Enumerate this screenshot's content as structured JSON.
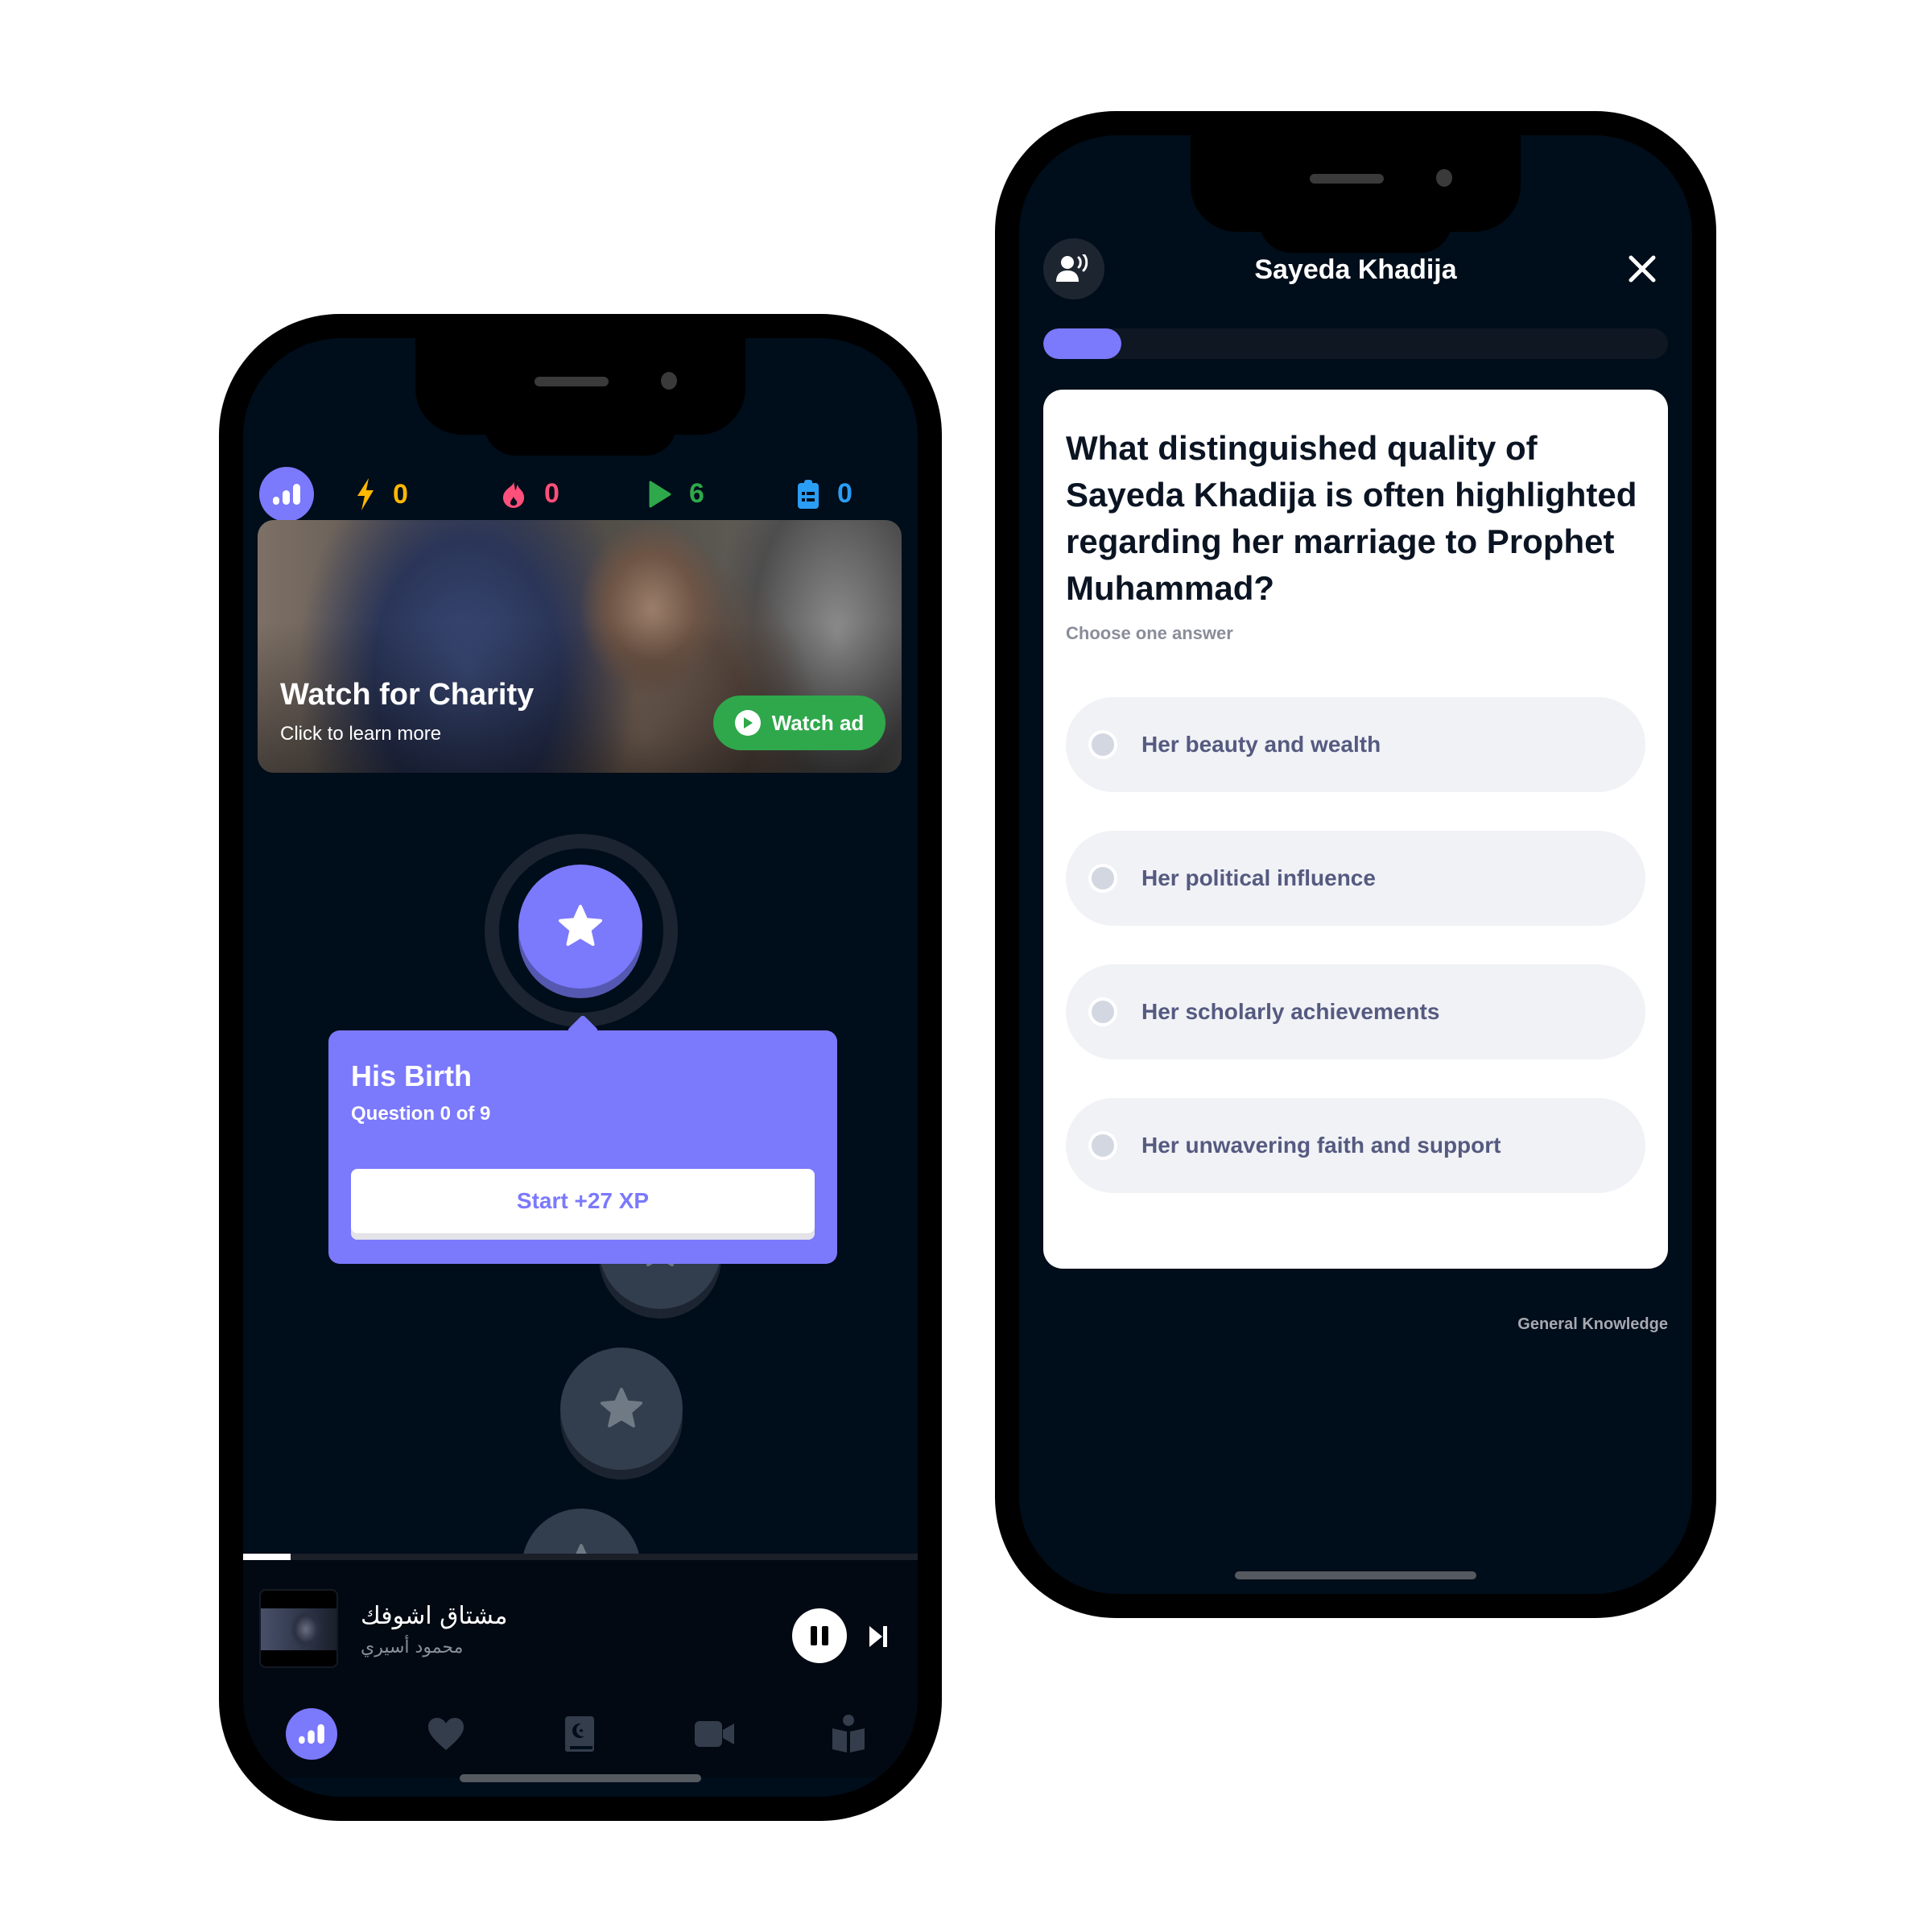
{
  "left_phone": {
    "stats": [
      {
        "icon": "lightning-icon",
        "value": "0",
        "color": "#ffb800"
      },
      {
        "icon": "flame-icon",
        "value": "0",
        "color": "#ff4f7b"
      },
      {
        "icon": "play-icon",
        "value": "6",
        "color": "#2ea84b"
      },
      {
        "icon": "clipboard-icon",
        "value": "0",
        "color": "#2a9df4"
      }
    ],
    "banner": {
      "title": "Watch for Charity",
      "subtitle": "Click to learn more",
      "button_label": "Watch ad"
    },
    "lesson_popover": {
      "title": "His Birth",
      "subtitle": "Question 0 of 9",
      "start_label": "Start +27 XP"
    },
    "player": {
      "track_title": "مشتاق اشوفك",
      "artist": "محمود أسيري",
      "progress_percent": 7
    },
    "tabbar": [
      {
        "icon": "stats-icon",
        "active": true
      },
      {
        "icon": "heart-icon",
        "active": false
      },
      {
        "icon": "quran-icon",
        "active": false
      },
      {
        "icon": "video-icon",
        "active": false
      },
      {
        "icon": "reader-icon",
        "active": false
      }
    ]
  },
  "right_phone": {
    "title": "Sayeda Khadija",
    "progress_percent": 12.5,
    "question": "What distinguished quality of Sayeda Khadija is often highlighted regarding her marriage to Prophet Muhammad?",
    "hint": "Choose one answer",
    "answers": [
      "Her beauty and wealth",
      "Her political influence",
      "Her scholarly achievements",
      "Her unwavering faith and support"
    ],
    "category": "General Knowledge"
  },
  "colors": {
    "accent": "#7b79fc",
    "background": "#000d1a",
    "watch_ad_green": "#2ea84b"
  }
}
